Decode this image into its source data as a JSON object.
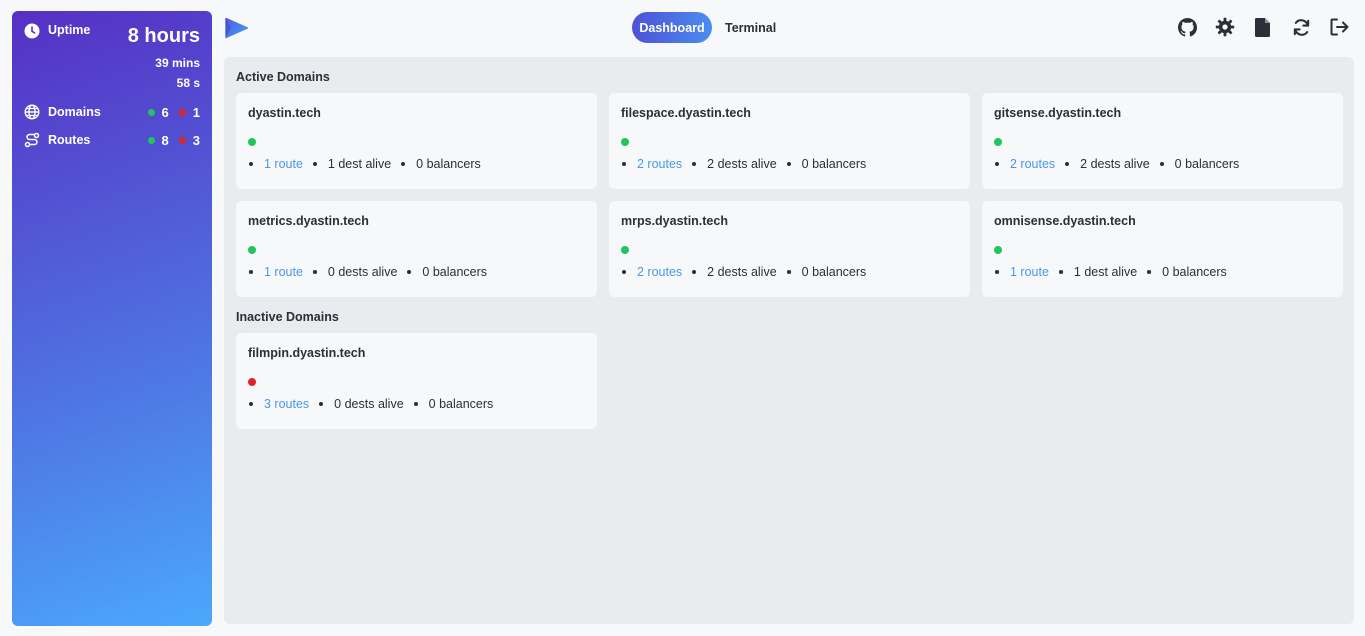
{
  "sidebar": {
    "uptime": {
      "label": "Uptime",
      "hours": "8 hours",
      "mins": "39 mins",
      "secs": "58 s"
    },
    "domains": {
      "label": "Domains",
      "up": "6",
      "down": "1"
    },
    "routes": {
      "label": "Routes",
      "up": "8",
      "down": "3"
    }
  },
  "nav": {
    "tabs": [
      {
        "label": "Dashboard",
        "active": true
      },
      {
        "label": "Terminal",
        "active": false
      }
    ],
    "icons": [
      "github-icon",
      "settings-icon",
      "document-icon",
      "refresh-icon",
      "logout-icon"
    ]
  },
  "main": {
    "active_title": "Active Domains",
    "inactive_title": "Inactive Domains",
    "active": [
      {
        "name": "dyastin.tech",
        "status": "up",
        "routes": "1 route",
        "dests": "1 dest alive",
        "balancers": "0 balancers"
      },
      {
        "name": "filespace.dyastin.tech",
        "status": "up",
        "routes": "2 routes",
        "dests": "2 dests alive",
        "balancers": "0 balancers"
      },
      {
        "name": "gitsense.dyastin.tech",
        "status": "up",
        "routes": "2 routes",
        "dests": "2 dests alive",
        "balancers": "0 balancers"
      },
      {
        "name": "metrics.dyastin.tech",
        "status": "up",
        "routes": "1 route",
        "dests": "0 dests alive",
        "balancers": "0 balancers"
      },
      {
        "name": "mrps.dyastin.tech",
        "status": "up",
        "routes": "2 routes",
        "dests": "2 dests alive",
        "balancers": "0 balancers"
      },
      {
        "name": "omnisense.dyastin.tech",
        "status": "up",
        "routes": "1 route",
        "dests": "1 dest alive",
        "balancers": "0 balancers"
      }
    ],
    "inactive": [
      {
        "name": "filmpin.dyastin.tech",
        "status": "down",
        "routes": "3 routes",
        "dests": "0 dests alive",
        "balancers": "0 balancers"
      }
    ]
  },
  "colors": {
    "status_up": "#21c55d",
    "status_down": "#dc2626",
    "link": "#4a98e6",
    "accent": "#4d52d6"
  }
}
